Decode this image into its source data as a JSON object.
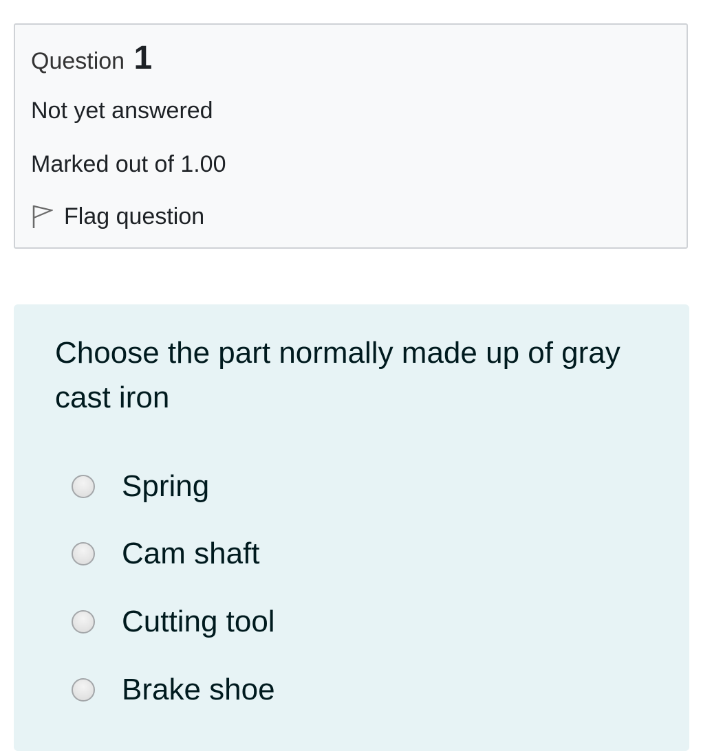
{
  "info": {
    "question_word": "Question",
    "question_number": "1",
    "state": "Not yet answered",
    "grade": "Marked out of 1.00",
    "flag_label": "Flag question"
  },
  "question": {
    "text": "Choose the part normally made up of gray cast iron",
    "answers": [
      {
        "label": "Spring",
        "selected": false
      },
      {
        "label": "Cam shaft",
        "selected": false
      },
      {
        "label": "Cutting tool",
        "selected": false
      },
      {
        "label": "Brake shoe",
        "selected": false
      }
    ]
  },
  "icons": {
    "flag": "flag-outline-icon"
  },
  "colors": {
    "info_background": "#f8f9fa",
    "info_border": "#cfd2d6",
    "content_background": "#e7f3f5",
    "text": "#001a1e"
  }
}
